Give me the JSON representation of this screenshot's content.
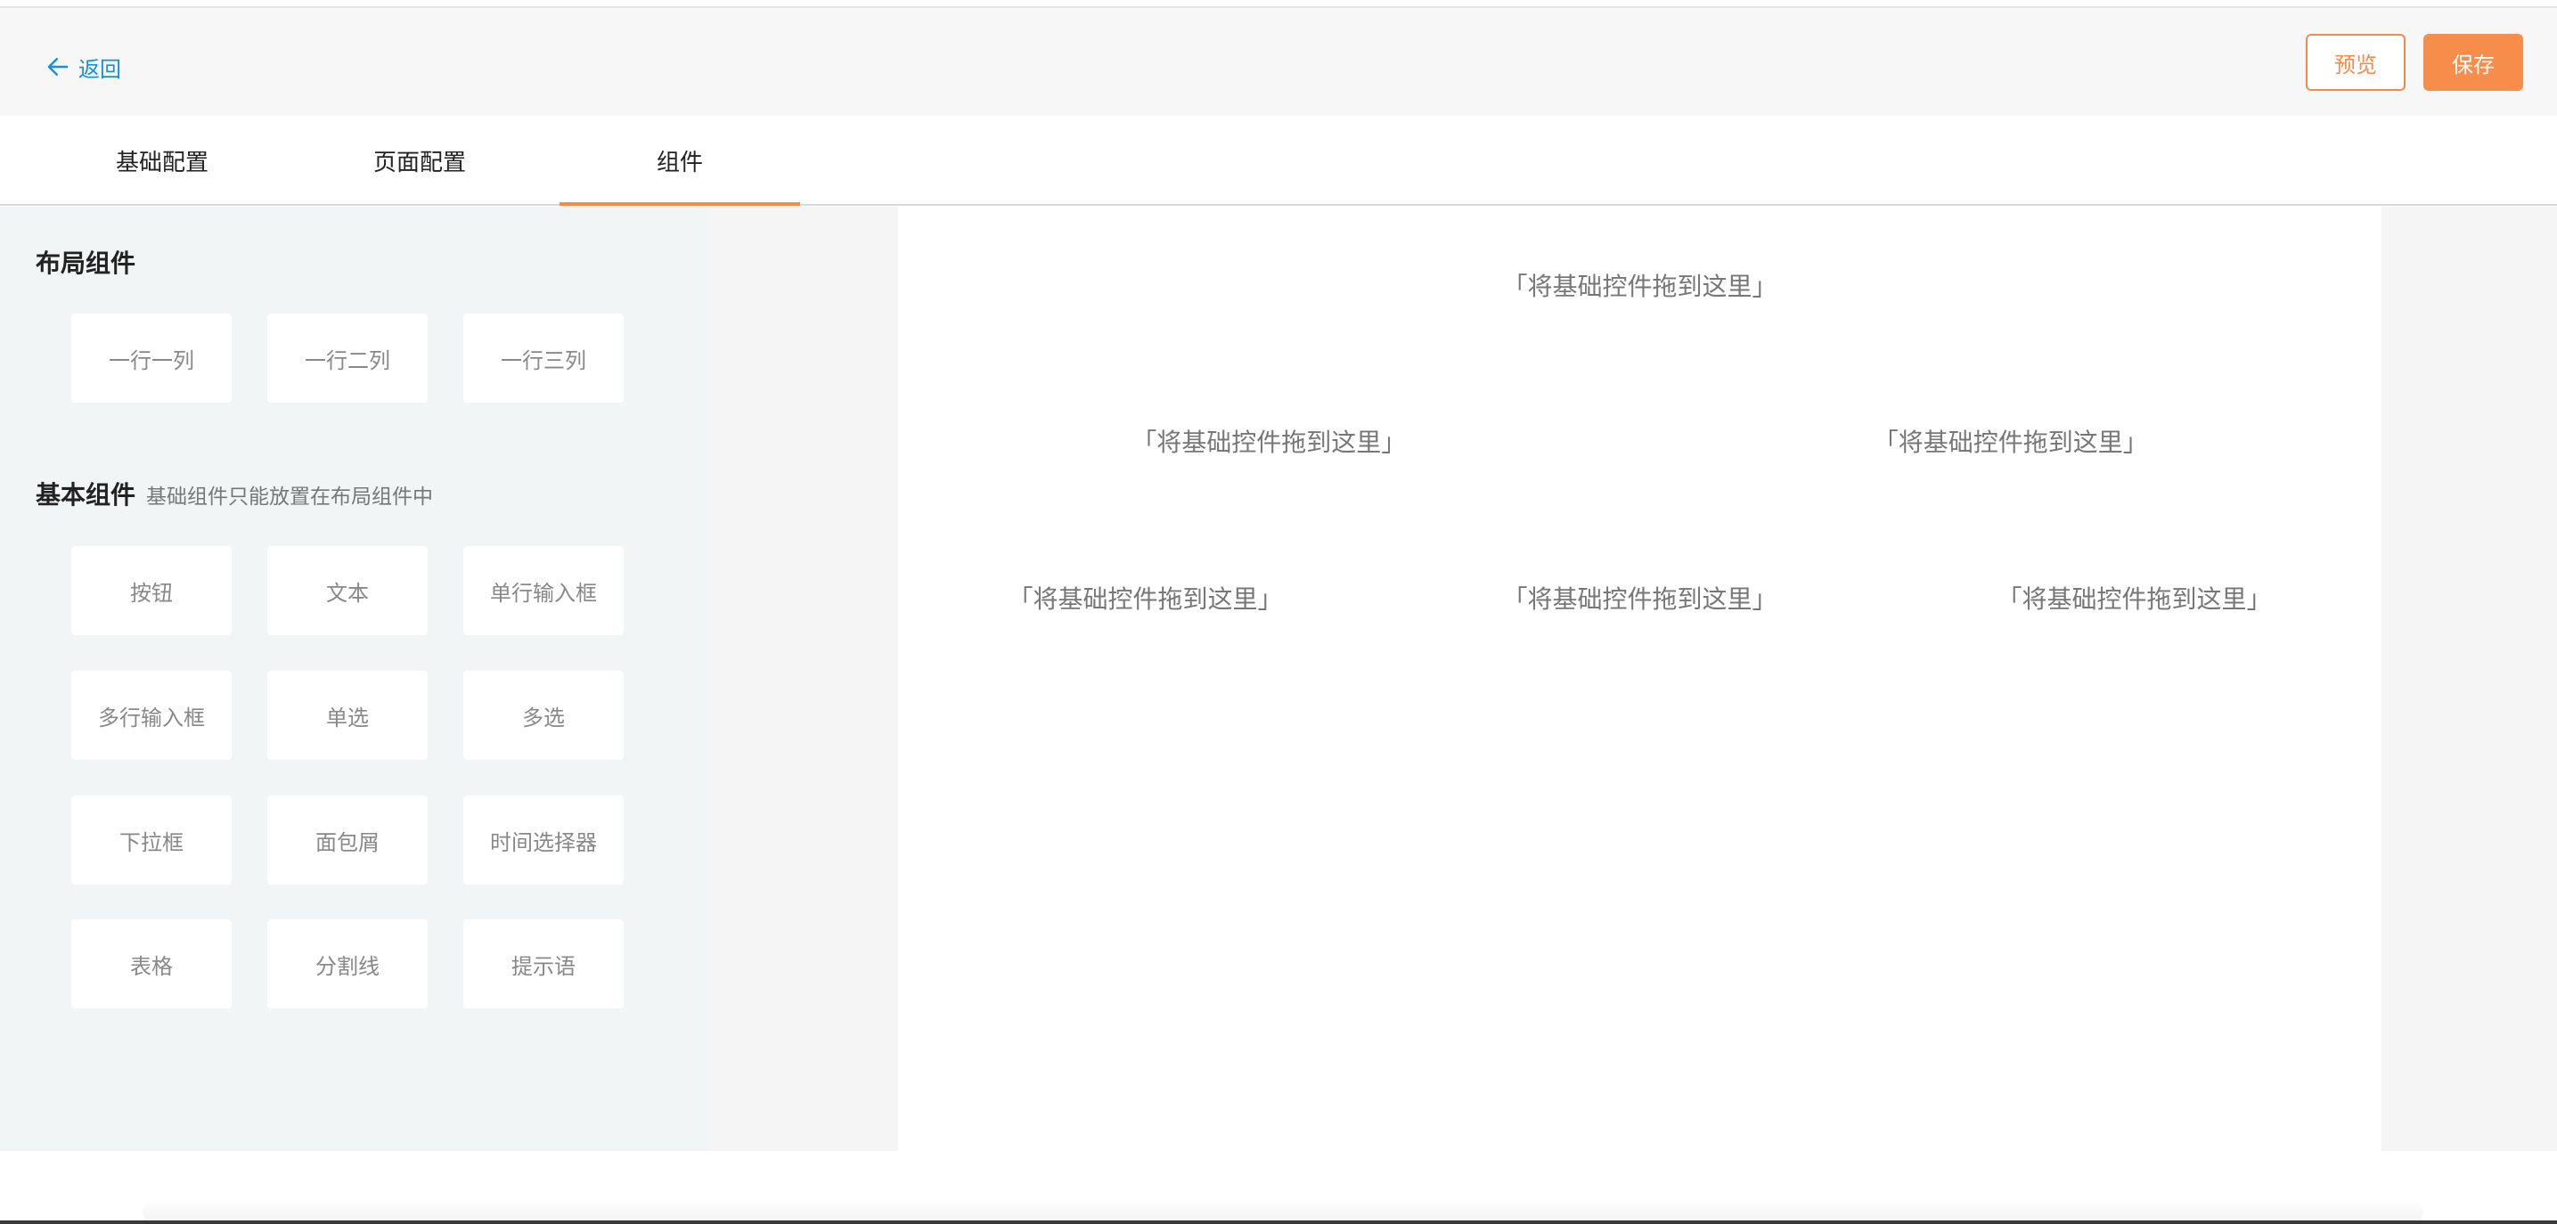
{
  "header": {
    "back_label": "返回",
    "preview_label": "预览",
    "save_label": "保存"
  },
  "tabs": [
    {
      "label": "基础配置",
      "active": false
    },
    {
      "label": "页面配置",
      "active": false
    },
    {
      "label": "组件",
      "active": true
    }
  ],
  "sidebar": {
    "layout_title": "布局组件",
    "layout_items": [
      "一行一列",
      "一行二列",
      "一行三列"
    ],
    "basic_title": "基本组件",
    "basic_hint": "基础组件只能放置在布局组件中",
    "basic_items": [
      "按钮",
      "文本",
      "单行输入框",
      "多行输入框",
      "单选",
      "多选",
      "下拉框",
      "面包屑",
      "时间选择器",
      "表格",
      "分割线",
      "提示语"
    ]
  },
  "canvas": {
    "rows": [
      [
        "「将基础控件拖到这里」"
      ],
      [
        "「将基础控件拖到这里」",
        "「将基础控件拖到这里」"
      ],
      [
        "「将基础控件拖到这里」",
        "「将基础控件拖到这里」",
        "「将基础控件拖到这里」"
      ]
    ]
  },
  "colors": {
    "accent": "#f48b4a",
    "link": "#1890d6",
    "sidebar_bg": "#f1f5f5"
  }
}
